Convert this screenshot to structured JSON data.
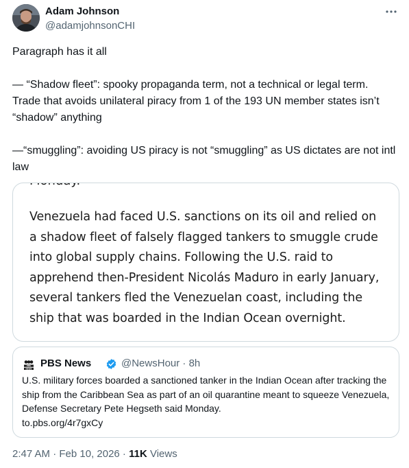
{
  "author": {
    "name": "Adam Johnson",
    "handle": "@adamjohnsonCHI",
    "avatar_icon": "user-avatar"
  },
  "tweet": {
    "paragraphs": [
      "Paragraph has it all",
      "— “Shadow fleet”: spooky propaganda term, not a technical or legal term. Trade that avoids unilateral piracy from 1 of the 193 UN member states isn’t “shadow” anything",
      "—“smuggling”: avoiding US piracy is not “smuggling” as US dictates are not intl law"
    ]
  },
  "image": {
    "cut_line": "Monday.",
    "text": "Venezuela had faced U.S. sanctions on its oil and relied on a shadow fleet of falsely flagged tankers to smuggle crude into global supply chains. Following the U.S. raid to apprehend then-President Nicolás Maduro in early January, several tankers fled the Venezuelan coast, including the ship that was boarded in the Indian Ocean overnight."
  },
  "quoted": {
    "logo_text": "PBS NEWS",
    "name": "PBS News",
    "handle": "@NewsHour · 8h",
    "text": "U.S. military forces boarded a sanctioned tanker in the Indian Ocean after tracking the ship from the Caribbean Sea as part of an oil quarantine meant to squeeze Venezuela, Defense Secretary Pete Hegseth said Monday.",
    "link": "to.pbs.org/4r7gxCy"
  },
  "footer": {
    "timestamp": "2:47 AM · Feb 10, 2026 · ",
    "views_count": "11K",
    "views_label": " Views"
  },
  "colors": {
    "text_primary": "#0f1419",
    "text_secondary": "#536471",
    "border": "#cfd9de",
    "verified": "#1d9bf0"
  }
}
